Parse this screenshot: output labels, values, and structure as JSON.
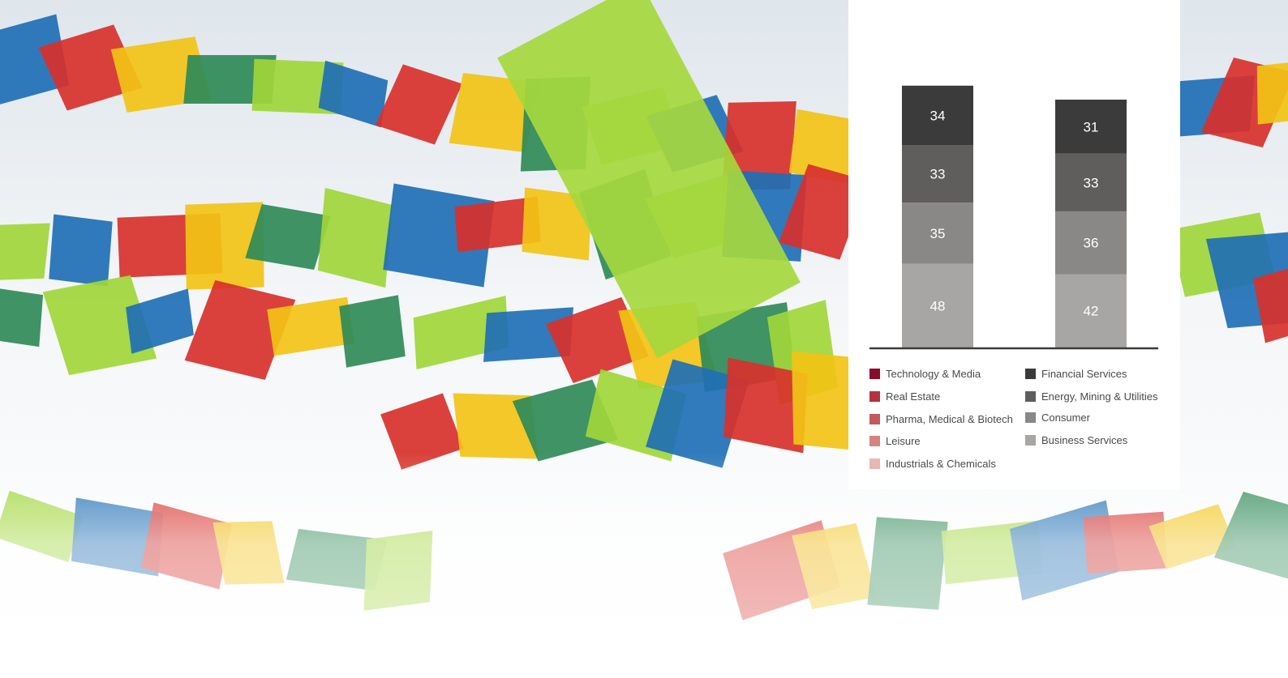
{
  "background": {
    "description_icon": "prayer-flags-photo",
    "colors": [
      "#1f6fb5",
      "#d8312b",
      "#f2c316",
      "#2f8a57",
      "#9fd63a",
      "#ffffff"
    ]
  },
  "chart_data": {
    "type": "bar",
    "stacked": true,
    "title": "",
    "xlabel": "",
    "ylabel": "",
    "categories": [
      "",
      ""
    ],
    "series": [
      {
        "name": "Business Services",
        "color": "#a8a6a4",
        "values": [
          48,
          42
        ],
        "labels": [
          "48",
          "42"
        ]
      },
      {
        "name": "Consumer",
        "color": "#8a8887",
        "values": [
          35,
          36
        ],
        "labels": [
          "35",
          "36"
        ]
      },
      {
        "name": "Energy, Mining & Utilities",
        "color": "#605e5d",
        "values": [
          33,
          33
        ],
        "labels": [
          "33",
          "33"
        ]
      },
      {
        "name": "Financial Services",
        "color": "#3c3b3b",
        "values": [
          34,
          31
        ],
        "labels": [
          "34",
          "31"
        ]
      }
    ],
    "label_color": "#ffffff",
    "axis_color": "#3c3b3b"
  },
  "legend": {
    "left": [
      {
        "label": "Technology & Media",
        "color": "#8b0a2a"
      },
      {
        "label": "Real Estate",
        "color": "#b5323e"
      },
      {
        "label": "Pharma, Medical & Biotech",
        "color": "#c45a5c"
      },
      {
        "label": "Leisure",
        "color": "#d4837f"
      },
      {
        "label": "Industrials & Chemicals",
        "color": "#e8b6b3"
      }
    ],
    "right": [
      {
        "label": "Financial Services",
        "color": "#3c3b3b"
      },
      {
        "label": "Energy, Mining & Utilities",
        "color": "#605e5d"
      },
      {
        "label": "Consumer",
        "color": "#8a8887"
      },
      {
        "label": "Business Services",
        "color": "#a8a6a4"
      }
    ]
  }
}
